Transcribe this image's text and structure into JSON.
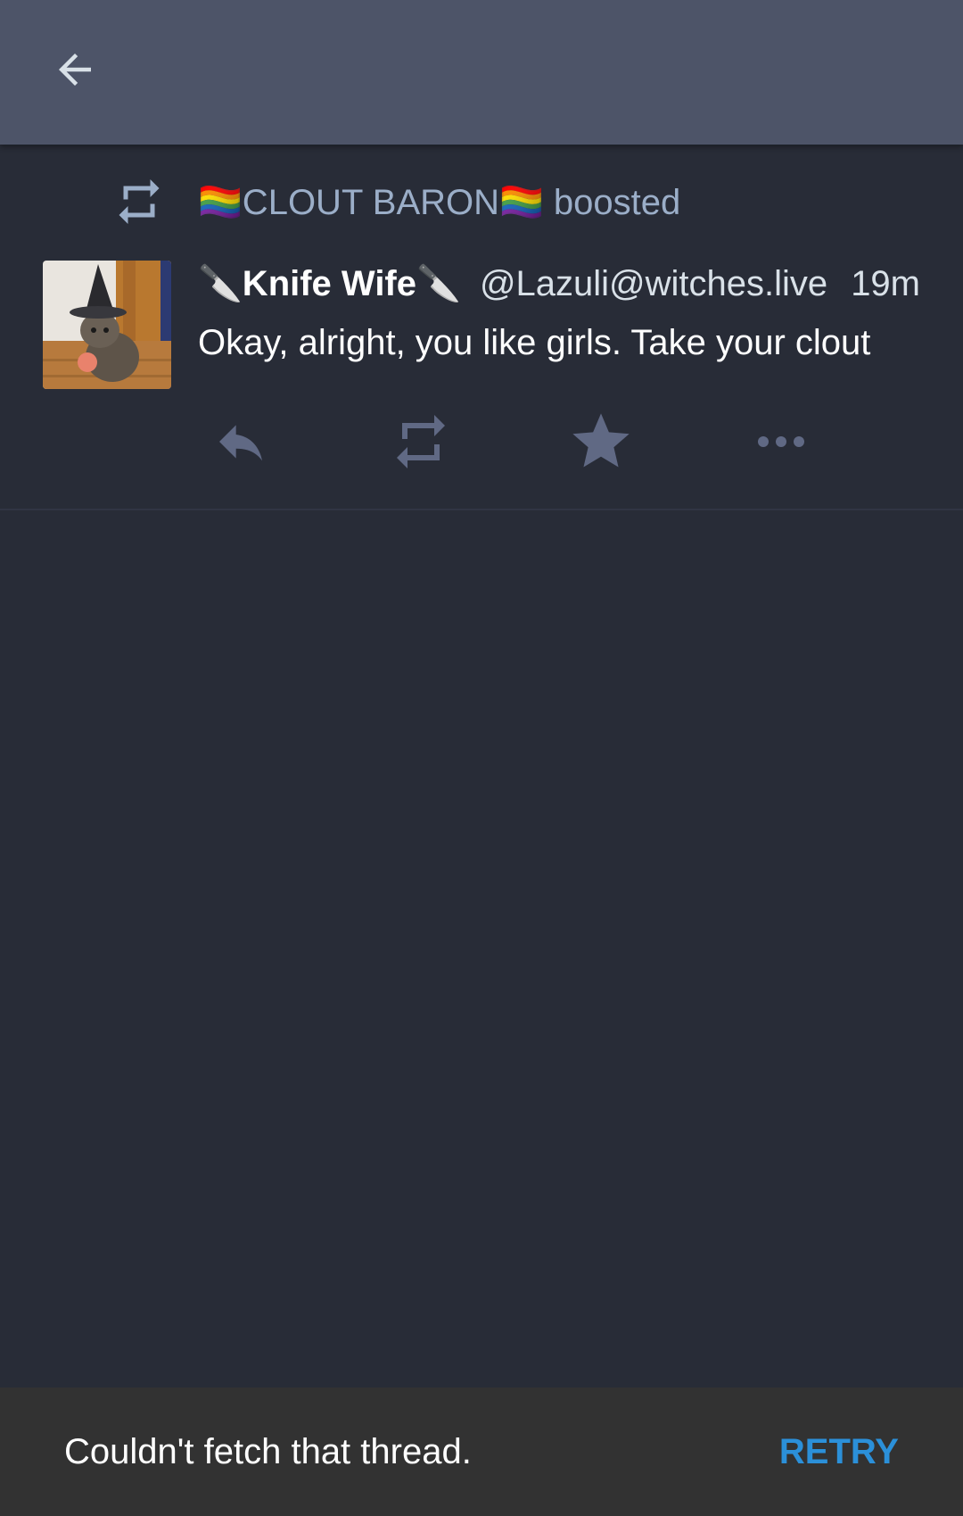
{
  "toolbar": {
    "back_icon": "arrow-left-icon"
  },
  "status": {
    "boost": {
      "icon": "boost-icon",
      "text": "🏳️‍🌈CLOUT BARON🏳️‍🌈 boosted"
    },
    "author": {
      "display_name": "🔪Knife Wife🔪",
      "username": "@Lazuli@witches.live",
      "avatar": "avatar-image"
    },
    "timestamp": "19m",
    "content": "Okay, alright, you like girls. Take your clout",
    "actions": {
      "reply_icon": "reply-icon",
      "boost_icon": "boost-icon",
      "favourite_icon": "star-icon",
      "more_icon": "more-icon"
    }
  },
  "snackbar": {
    "message": "Couldn't fetch that thread.",
    "action_label": "RETRY"
  },
  "colors": {
    "toolbar": "#4d5468",
    "background": "#282c37",
    "secondary_text": "#9baec8",
    "action_icons": "#606984",
    "snackbar": "#323232",
    "accent": "#2b90d9"
  }
}
